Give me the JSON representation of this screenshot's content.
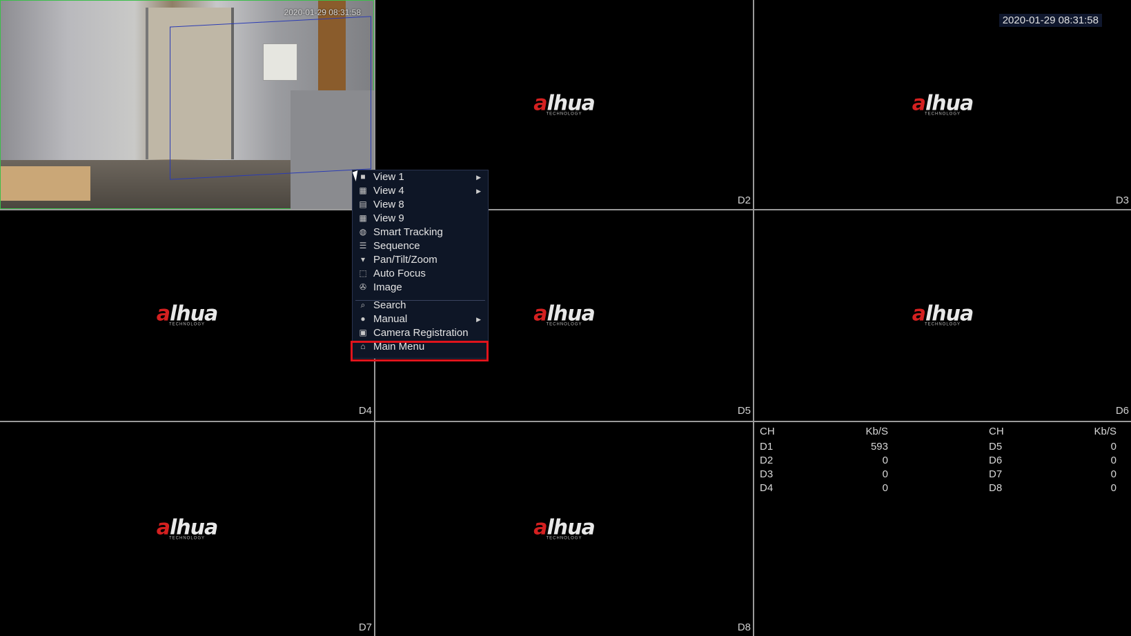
{
  "timestamp": "2020-01-29 08:31:58",
  "feed_timestamp": "2020-01-29 08:31:58",
  "logo": {
    "word": "alhua",
    "tagline": "TECHNOLOGY"
  },
  "channels": [
    "D2",
    "D3",
    "D4",
    "D5",
    "D6",
    "D7",
    "D8"
  ],
  "menu": {
    "items": [
      {
        "label": "View 1",
        "icon": "view1-icon",
        "submenu": true
      },
      {
        "label": "View 4",
        "icon": "view4-icon",
        "submenu": true
      },
      {
        "label": "View 8",
        "icon": "view8-icon",
        "submenu": false
      },
      {
        "label": "View 9",
        "icon": "view9-icon",
        "submenu": false
      },
      {
        "label": "Smart Tracking",
        "icon": "smart-tracking-icon",
        "submenu": false
      },
      {
        "label": "Sequence",
        "icon": "sequence-icon",
        "submenu": false
      },
      {
        "label": "Pan/Tilt/Zoom",
        "icon": "ptz-icon",
        "submenu": false
      },
      {
        "label": "Auto Focus",
        "icon": "auto-focus-icon",
        "submenu": false
      },
      {
        "label": "Image",
        "icon": "image-icon",
        "submenu": false
      },
      {
        "label": "Search",
        "icon": "search-icon",
        "submenu": false
      },
      {
        "label": "Manual",
        "icon": "manual-icon",
        "submenu": true
      },
      {
        "label": "Camera Registration",
        "icon": "camera-registration-icon",
        "submenu": false
      },
      {
        "label": "Main Menu",
        "icon": "home-icon",
        "submenu": false,
        "highlighted": true
      }
    ]
  },
  "bitrate": {
    "headers": [
      "CH",
      "Kb/S",
      "CH",
      "Kb/S"
    ],
    "rows": [
      [
        "D1",
        "593",
        "D5",
        "0"
      ],
      [
        "D2",
        "0",
        "D6",
        "0"
      ],
      [
        "D3",
        "0",
        "D7",
        "0"
      ],
      [
        "D4",
        "0",
        "D8",
        "0"
      ]
    ]
  },
  "colors": {
    "highlight": "#e0141c",
    "menu_bg": "#0e1626",
    "feed_border": "#3bbf4a",
    "roi": "#2a3bb5"
  }
}
